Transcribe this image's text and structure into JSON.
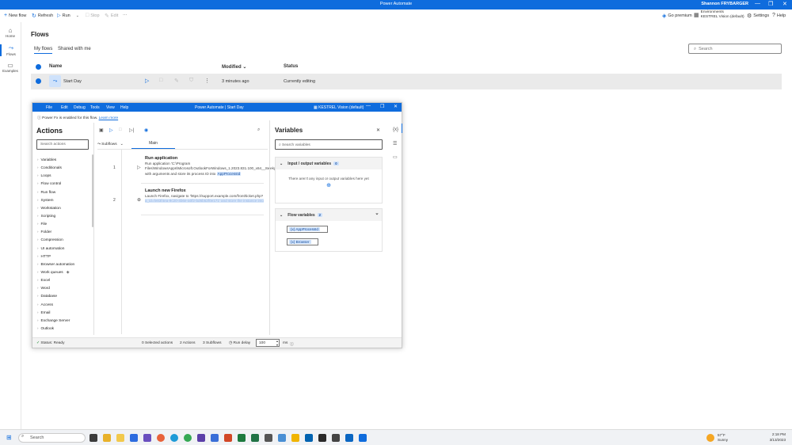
{
  "titlebar": {
    "title": "Power Automate",
    "user": "Shannon FRYBARGER",
    "controls": [
      "—",
      "❐",
      "✕"
    ]
  },
  "toolbar": {
    "new_flow": "New flow",
    "refresh": "Refresh",
    "run": "Run",
    "stop": "Stop",
    "edit": "Edit",
    "more": "···",
    "go_premium": "Go premium",
    "environments_label": "Environments",
    "environment_name": "KESTREL Vision (default)",
    "settings": "Settings",
    "help": "Help"
  },
  "leftnav": {
    "items": [
      {
        "label": "Home",
        "icon": "home-icon"
      },
      {
        "label": "Flows",
        "icon": "flow-icon"
      },
      {
        "label": "Examples",
        "icon": "book-icon"
      }
    ]
  },
  "flows_page": {
    "title": "Flows",
    "tabs": [
      "My flows",
      "Shared with me"
    ],
    "search_placeholder": "Search",
    "columns": {
      "name": "Name",
      "modified": "Modified",
      "modified_sort": "⌄",
      "status": "Status"
    },
    "rows": [
      {
        "name": "Start Day",
        "modified": "3 minutes ago",
        "status": "Currently editing"
      }
    ]
  },
  "pad": {
    "menu": [
      "File",
      "Edit",
      "Debug",
      "Tools",
      "View",
      "Help"
    ],
    "title": "Power Automate | Start Day",
    "environment": "KESTREL Vision (default)",
    "info_text": "Power Fx is enabled for this flow.",
    "info_link": "Learn more",
    "actions_panel": {
      "title": "Actions",
      "search_placeholder": "Search actions",
      "items": [
        "Variables",
        "Conditionals",
        "Loops",
        "Flow control",
        "Run flow",
        "System",
        "Workstation",
        "Scripting",
        "File",
        "Folder",
        "Compression",
        "UI automation",
        "HTTP",
        "Browser automation",
        "Work queues",
        "Excel",
        "Word",
        "Database",
        "Access",
        "Email",
        "Exchange Server",
        "Outlook"
      ]
    },
    "designer": {
      "subflows": "Subflows",
      "main_tab": "Main",
      "steps": [
        {
          "number": "1",
          "title": "Run application",
          "desc_prefix": "Run application 'C:\\Program Files\\WindowsApps\\Microsoft.OutlookForWindows_1.2023.831.100_x64__8wekyb3d8bbwe\\olk.exe' with arguments  and store its process ID into",
          "var": "AppProcessId"
        },
        {
          "number": "2",
          "title": "Launch new Firefox",
          "desc_prefix": "Launch Firefox, navigate to 'https://support.example.com/front/ticket.php?",
          "desc_blur": "a_id=fe83f4ea-9c20-4b6e-a0f2-bd6b52f0e171' and store the instance into"
        }
      ]
    },
    "variables": {
      "title": "Variables",
      "search_placeholder": "Search variables",
      "io_section": {
        "label": "Input / output variables",
        "count": "0",
        "empty_text": "There aren't any input or output variables here yet"
      },
      "flow_section": {
        "label": "Flow variables",
        "count": "2",
        "vars": [
          "AppProcessId",
          "Browser"
        ]
      }
    },
    "status": {
      "ready": "Status: Ready",
      "selected": "0 Selected actions",
      "actions": "2 Actions",
      "subflows": "3 Subflows",
      "run_delay_label": "Run delay",
      "run_delay_value": "100",
      "unit": "ms"
    }
  },
  "taskbar": {
    "search": "Search",
    "weather_temp": "57°F",
    "weather_desc": "Sunny",
    "time": "2:18 PM",
    "date": "3/13/2023"
  },
  "colors": {
    "accent": "#0f6cdd",
    "highlight": "#cfe2fb"
  }
}
